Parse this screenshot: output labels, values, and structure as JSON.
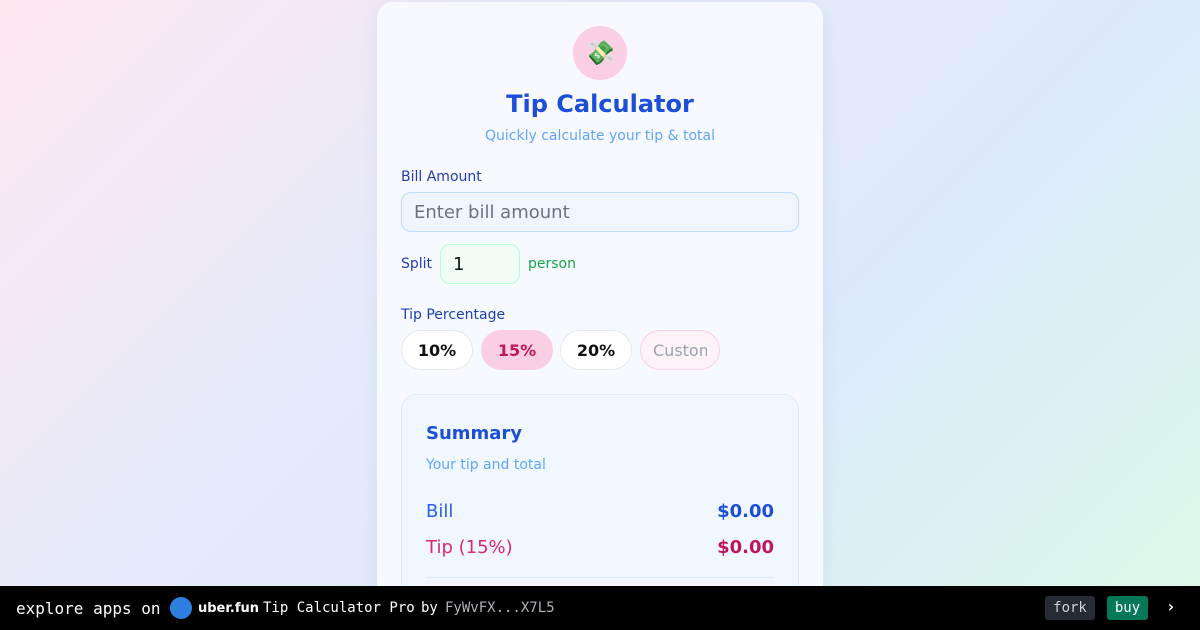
{
  "card": {
    "icon": "money-with-wings-icon",
    "icon_glyph": "💸",
    "title": "Tip Calculator",
    "subtitle": "Quickly calculate your tip & total"
  },
  "bill": {
    "label": "Bill Amount",
    "placeholder": "Enter bill amount",
    "value": ""
  },
  "split": {
    "label": "Split",
    "value": "1",
    "unit": "person"
  },
  "tip": {
    "label": "Tip Percentage",
    "options": [
      "10%",
      "15%",
      "20%"
    ],
    "selected": "15%",
    "custom_placeholder": "Custom"
  },
  "summary": {
    "title": "Summary",
    "subtitle": "Your tip and total",
    "bill_label": "Bill",
    "bill_value": "$0.00",
    "tip_label": "Tip (15%)",
    "tip_value": "$0.00"
  },
  "footer": {
    "explore": "explore apps on",
    "brand": "uber.fun",
    "app_name": "Tip Calculator Pro",
    "by": "by",
    "author": "FyWvFX...X7L5",
    "fork": "fork",
    "buy": "buy",
    "chevron": "›"
  },
  "colors": {
    "accent": "#1d4ed8",
    "pink": "#be185d",
    "green": "#16a34a",
    "buy": "#047857"
  }
}
